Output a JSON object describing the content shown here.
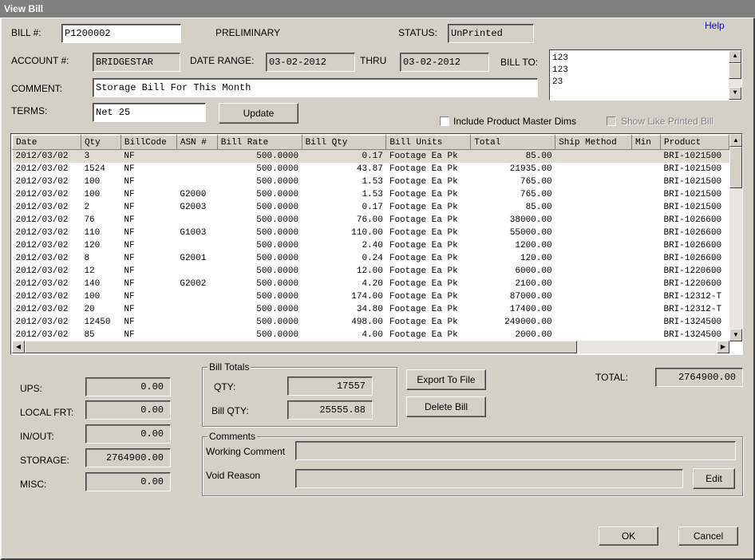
{
  "window": {
    "title": "View Bill"
  },
  "header": {
    "bill_label": "BILL #:",
    "bill_value": "P1200002",
    "preliminary": "PRELIMINARY",
    "status_label": "STATUS:",
    "status_value": "UnPrinted",
    "help": "Help",
    "account_label": "ACCOUNT #:",
    "account_value": "BRIDGESTAR",
    "date_range_label": "DATE RANGE:",
    "date_from": "03-02-2012",
    "thru_label": "THRU",
    "date_to": "03-02-2012",
    "bill_to_label": "BILL TO:",
    "bill_to_lines": [
      "123",
      "123",
      "23"
    ],
    "comment_label": "COMMENT:",
    "comment_value": "Storage Bill For This Month",
    "terms_label": "TERMS:",
    "terms_value": "Net 25",
    "update_button": "Update",
    "include_dims_label": "Include Product Master Dims",
    "include_dims_checked": false,
    "show_like_printed_label": "Show Like Printed Bill",
    "show_like_printed_checked": false
  },
  "grid": {
    "columns": [
      "Date",
      "Qty",
      "BillCode",
      "ASN #",
      "Bill Rate",
      "Bill Qty",
      "Bill Units",
      "Total",
      "Ship Method",
      "Min",
      "Product"
    ],
    "rows": [
      [
        "2012/03/02",
        "3",
        "NF",
        "",
        "500.0000",
        "0.17",
        "Footage Ea Pk",
        "85.00",
        "",
        "",
        "BRI-1021500"
      ],
      [
        "2012/03/02",
        "1524",
        "NF",
        "",
        "500.0000",
        "43.87",
        "Footage Ea Pk",
        "21935.00",
        "",
        "",
        "BRI-1021500"
      ],
      [
        "2012/03/02",
        "100",
        "NF",
        "",
        "500.0000",
        "1.53",
        "Footage Ea Pk",
        "765.00",
        "",
        "",
        "BRI-1021500"
      ],
      [
        "2012/03/02",
        "100",
        "NF",
        "G2000",
        "500.0000",
        "1.53",
        "Footage Ea Pk",
        "765.00",
        "",
        "",
        "BRI-1021500"
      ],
      [
        "2012/03/02",
        "2",
        "NF",
        "G2003",
        "500.0000",
        "0.17",
        "Footage Ea Pk",
        "85.00",
        "",
        "",
        "BRI-1021500"
      ],
      [
        "2012/03/02",
        "76",
        "NF",
        "",
        "500.0000",
        "76.00",
        "Footage Ea Pk",
        "38000.00",
        "",
        "",
        "BRI-1026600"
      ],
      [
        "2012/03/02",
        "110",
        "NF",
        "G1003",
        "500.0000",
        "110.00",
        "Footage Ea Pk",
        "55000.00",
        "",
        "",
        "BRI-1026600"
      ],
      [
        "2012/03/02",
        "120",
        "NF",
        "",
        "500.0000",
        "2.40",
        "Footage Ea Pk",
        "1200.00",
        "",
        "",
        "BRI-1026600"
      ],
      [
        "2012/03/02",
        "8",
        "NF",
        "G2001",
        "500.0000",
        "0.24",
        "Footage Ea Pk",
        "120.00",
        "",
        "",
        "BRI-1026600"
      ],
      [
        "2012/03/02",
        "12",
        "NF",
        "",
        "500.0000",
        "12.00",
        "Footage Ea Pk",
        "6000.00",
        "",
        "",
        "BRI-1220600"
      ],
      [
        "2012/03/02",
        "140",
        "NF",
        "G2002",
        "500.0000",
        "4.20",
        "Footage Ea Pk",
        "2100.00",
        "",
        "",
        "BRI-1220600"
      ],
      [
        "2012/03/02",
        "100",
        "NF",
        "",
        "500.0000",
        "174.00",
        "Footage Ea Pk",
        "87000.00",
        "",
        "",
        "BRI-12312-T"
      ],
      [
        "2012/03/02",
        "20",
        "NF",
        "",
        "500.0000",
        "34.80",
        "Footage Ea Pk",
        "17400.00",
        "",
        "",
        "BRI-12312-T"
      ],
      [
        "2012/03/02",
        "12450",
        "NF",
        "",
        "500.0000",
        "498.00",
        "Footage Ea Pk",
        "249000.00",
        "",
        "",
        "BRI-1324500"
      ],
      [
        "2012/03/02",
        "85",
        "NF",
        "",
        "500.0000",
        "4.00",
        "Footage Ea Pk",
        "2000.00",
        "",
        "",
        "BRI-1324500"
      ]
    ]
  },
  "charges": {
    "ups_label": "UPS:",
    "ups_value": "0.00",
    "local_frt_label": "LOCAL FRT:",
    "local_frt_value": "0.00",
    "in_out_label": "IN/OUT:",
    "in_out_value": "0.00",
    "storage_label": "STORAGE:",
    "storage_value": "2764900.00",
    "misc_label": "MISC:",
    "misc_value": "0.00"
  },
  "bill_totals": {
    "title": "Bill Totals",
    "qty_label": "QTY:",
    "qty_value": "17557",
    "bill_qty_label": "Bill QTY:",
    "bill_qty_value": "25555.88"
  },
  "actions": {
    "export_button": "Export To File",
    "delete_button": "Delete Bill",
    "total_label": "TOTAL:",
    "total_value": "2764900.00",
    "ok_button": "OK",
    "cancel_button": "Cancel"
  },
  "comments": {
    "title": "Comments",
    "working_label": "Working Comment",
    "working_value": "",
    "void_label": "Void Reason",
    "void_value": "",
    "edit_button": "Edit"
  }
}
